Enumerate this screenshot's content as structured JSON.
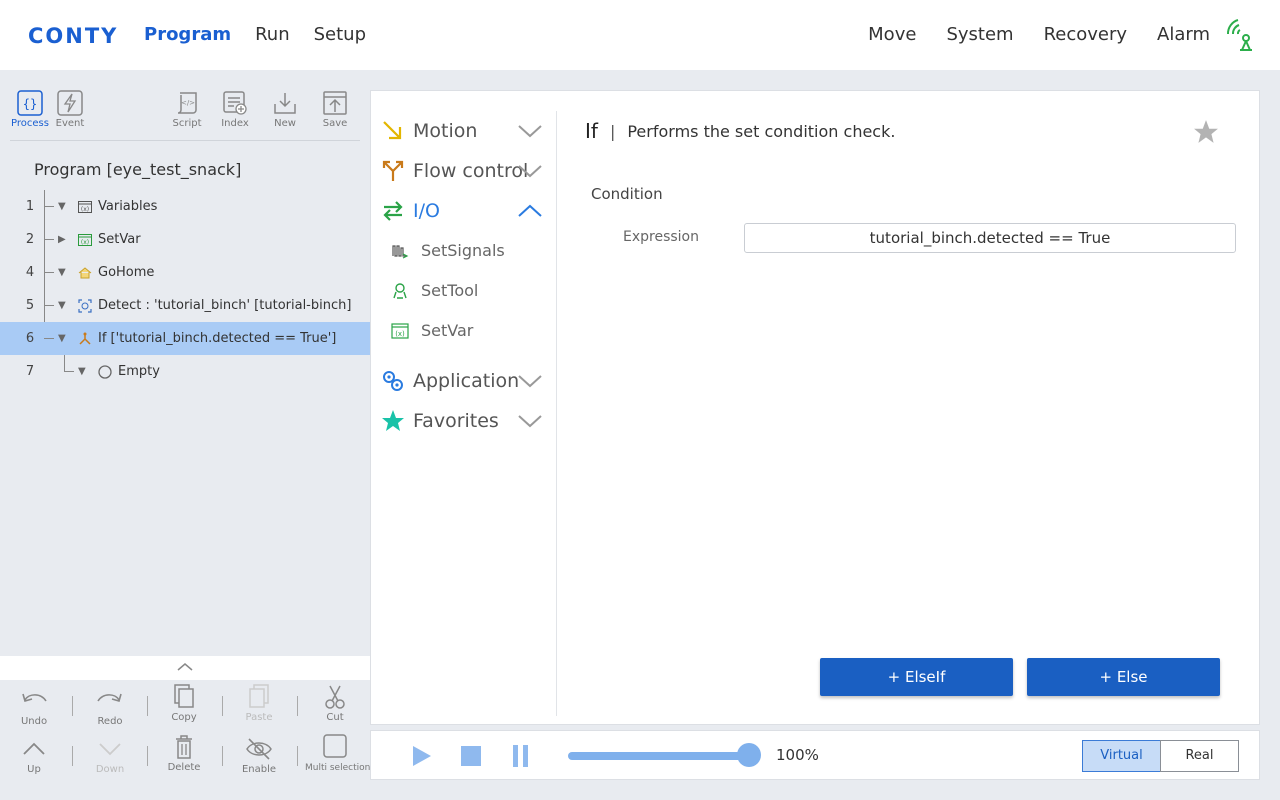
{
  "app": {
    "logo": "CONTY"
  },
  "nav": {
    "left": [
      "Program",
      "Run",
      "Setup"
    ],
    "right": [
      "Move",
      "System",
      "Recovery",
      "Alarm"
    ]
  },
  "toolbar": {
    "process": "Process",
    "event": "Event",
    "script": "Script",
    "index": "Index",
    "new": "New",
    "save": "Save"
  },
  "program": {
    "title": "Program [eye_test_snack]",
    "rows": [
      {
        "num": "1",
        "label": "Variables"
      },
      {
        "num": "2",
        "label": "SetVar"
      },
      {
        "num": "4",
        "label": "GoHome"
      },
      {
        "num": "5",
        "label": "Detect : 'tutorial_binch' [tutorial-binch]"
      },
      {
        "num": "6",
        "label": "If ['tutorial_binch.detected  == True']"
      },
      {
        "num": "7",
        "label": "Empty"
      }
    ]
  },
  "edit_tools": {
    "undo": "Undo",
    "redo": "Redo",
    "copy": "Copy",
    "paste": "Paste",
    "cut": "Cut",
    "up": "Up",
    "down": "Down",
    "delete": "Delete",
    "enable": "Enable",
    "multi": "Multi selection"
  },
  "categories": {
    "motion": "Motion",
    "flow": "Flow control",
    "io": "I/O",
    "io_items": [
      "SetSignals",
      "SetTool",
      "SetVar"
    ],
    "application": "Application",
    "favorites": "Favorites"
  },
  "detail": {
    "command": "If",
    "separator": "|",
    "description": "Performs the set condition check.",
    "condition_label": "Condition",
    "expression_label": "Expression",
    "expression_value": "tutorial_binch.detected  == True",
    "elseif_button": "+ ElseIf",
    "else_button": "+ Else"
  },
  "runbar": {
    "speed": "100%",
    "virtual": "Virtual",
    "real": "Real"
  },
  "colors": {
    "accent": "#1a5fd1",
    "selected_row": "#a9cbf5",
    "button": "#1a5fc2"
  }
}
